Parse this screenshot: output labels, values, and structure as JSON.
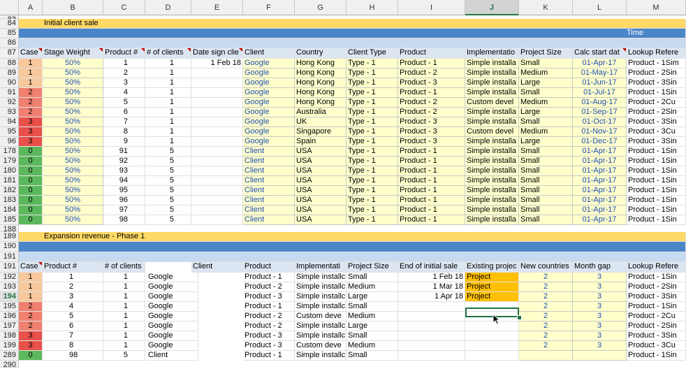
{
  "columns": [
    "A",
    "B",
    "C",
    "D",
    "E",
    "F",
    "G",
    "H",
    "I",
    "J",
    "K",
    "L",
    "M"
  ],
  "selected_column": "J",
  "bands": {
    "initial_title": "Initial client sale",
    "time_label": "Time",
    "expansion_title": "Expansion revenue - Phase 1"
  },
  "row_numbers": {
    "r83": "83",
    "r84": "84",
    "r85": "85",
    "r86": "86",
    "r87": "87",
    "r188": "188",
    "r189": "189",
    "r190": "190",
    "r191": "191",
    "r289": "289",
    "r290": "290"
  },
  "header1": {
    "case": "Case",
    "stage_weight": "Stage Weight",
    "product_num": "Product #",
    "num_clients": "# of clients",
    "date_sign": "Date sign clie",
    "client": "Client",
    "country": "Country",
    "client_type": "Client Type",
    "product": "Product",
    "implementation": "Implementatio",
    "project_size": "Project Size",
    "calc_start": "Calc start dat",
    "lookup_ref": "Lookup Refere"
  },
  "initial_rows": [
    {
      "n": "88",
      "case": "1",
      "w": "50%",
      "p": "1",
      "nc": "1",
      "date": "1 Feb 18",
      "client": "Google",
      "country": "Hong Kong",
      "type": "Type - 1",
      "prod": "Product - 1",
      "impl": "Simple installa",
      "size": "Small",
      "start": "01-Apr-17",
      "ref": "Product - 1Sim"
    },
    {
      "n": "89",
      "case": "1",
      "w": "50%",
      "p": "2",
      "nc": "1",
      "date": "",
      "client": "Google",
      "country": "Hong Kong",
      "type": "Type - 1",
      "prod": "Product - 2",
      "impl": "Simple installa",
      "size": "Medium",
      "start": "01-May-17",
      "ref": "Product - 2Sin"
    },
    {
      "n": "90",
      "case": "1",
      "w": "50%",
      "p": "3",
      "nc": "1",
      "date": "",
      "client": "Google",
      "country": "Hong Kong",
      "type": "Type - 1",
      "prod": "Product - 3",
      "impl": "Simple installa",
      "size": "Large",
      "start": "01-Jun-17",
      "ref": "Product - 3Sin"
    },
    {
      "n": "91",
      "case": "2",
      "w": "50%",
      "p": "4",
      "nc": "1",
      "date": "",
      "client": "Google",
      "country": "Hong Kong",
      "type": "Type - 1",
      "prod": "Product - 1",
      "impl": "Simple installa",
      "size": "Small",
      "start": "01-Jul-17",
      "ref": "Product - 1Sin"
    },
    {
      "n": "92",
      "case": "2",
      "w": "50%",
      "p": "5",
      "nc": "1",
      "date": "",
      "client": "Google",
      "country": "Hong Kong",
      "type": "Type - 1",
      "prod": "Product - 2",
      "impl": "Custom devel",
      "size": "Medium",
      "start": "01-Aug-17",
      "ref": "Product - 2Cu"
    },
    {
      "n": "93",
      "case": "2",
      "w": "50%",
      "p": "6",
      "nc": "1",
      "date": "",
      "client": "Google",
      "country": "Australia",
      "type": "Type - 1",
      "prod": "Product - 2",
      "impl": "Simple installa",
      "size": "Large",
      "start": "01-Sep-17",
      "ref": "Product - 2Sin"
    },
    {
      "n": "94",
      "case": "3",
      "w": "50%",
      "p": "7",
      "nc": "1",
      "date": "",
      "client": "Google",
      "country": "UK",
      "type": "Type - 1",
      "prod": "Product - 3",
      "impl": "Simple installa",
      "size": "Small",
      "start": "01-Oct-17",
      "ref": "Product - 3Sin"
    },
    {
      "n": "95",
      "case": "3",
      "w": "50%",
      "p": "8",
      "nc": "1",
      "date": "",
      "client": "Google",
      "country": "Singapore",
      "type": "Type - 1",
      "prod": "Product - 3",
      "impl": "Custom devel",
      "size": "Medium",
      "start": "01-Nov-17",
      "ref": "Product - 3Cu"
    },
    {
      "n": "96",
      "case": "3",
      "w": "50%",
      "p": "9",
      "nc": "1",
      "date": "",
      "client": "Google",
      "country": "Spain",
      "type": "Type - 1",
      "prod": "Product - 3",
      "impl": "Simple installa",
      "size": "Large",
      "start": "01-Dec-17",
      "ref": "Product - 3Sin"
    },
    {
      "n": "178",
      "case": "0",
      "w": "50%",
      "p": "91",
      "nc": "5",
      "date": "",
      "client": "Client",
      "country": "USA",
      "type": "Type - 1",
      "prod": "Product - 1",
      "impl": "Simple installa",
      "size": "Small",
      "start": "01-Apr-17",
      "ref": "Product - 1Sin"
    },
    {
      "n": "179",
      "case": "0",
      "w": "50%",
      "p": "92",
      "nc": "5",
      "date": "",
      "client": "Client",
      "country": "USA",
      "type": "Type - 1",
      "prod": "Product - 1",
      "impl": "Simple installa",
      "size": "Small",
      "start": "01-Apr-17",
      "ref": "Product - 1Sin"
    },
    {
      "n": "180",
      "case": "0",
      "w": "50%",
      "p": "93",
      "nc": "5",
      "date": "",
      "client": "Client",
      "country": "USA",
      "type": "Type - 1",
      "prod": "Product - 1",
      "impl": "Simple installa",
      "size": "Small",
      "start": "01-Apr-17",
      "ref": "Product - 1Sin"
    },
    {
      "n": "181",
      "case": "0",
      "w": "50%",
      "p": "94",
      "nc": "5",
      "date": "",
      "client": "Client",
      "country": "USA",
      "type": "Type - 1",
      "prod": "Product - 1",
      "impl": "Simple installa",
      "size": "Small",
      "start": "01-Apr-17",
      "ref": "Product - 1Sin"
    },
    {
      "n": "182",
      "case": "0",
      "w": "50%",
      "p": "95",
      "nc": "5",
      "date": "",
      "client": "Client",
      "country": "USA",
      "type": "Type - 1",
      "prod": "Product - 1",
      "impl": "Simple installa",
      "size": "Small",
      "start": "01-Apr-17",
      "ref": "Product - 1Sin"
    },
    {
      "n": "183",
      "case": "0",
      "w": "50%",
      "p": "96",
      "nc": "5",
      "date": "",
      "client": "Client",
      "country": "USA",
      "type": "Type - 1",
      "prod": "Product - 1",
      "impl": "Simple installa",
      "size": "Small",
      "start": "01-Apr-17",
      "ref": "Product - 1Sin"
    },
    {
      "n": "184",
      "case": "0",
      "w": "50%",
      "p": "97",
      "nc": "5",
      "date": "",
      "client": "Client",
      "country": "USA",
      "type": "Type - 1",
      "prod": "Product - 1",
      "impl": "Simple installa",
      "size": "Small",
      "start": "01-Apr-17",
      "ref": "Product - 1Sin"
    },
    {
      "n": "185",
      "case": "0",
      "w": "50%",
      "p": "98",
      "nc": "5",
      "date": "",
      "client": "Client",
      "country": "USA",
      "type": "Type - 1",
      "prod": "Product - 1",
      "impl": "Simple installa",
      "size": "Small",
      "start": "01-Apr-17",
      "ref": "Product - 1Sin"
    }
  ],
  "header2": {
    "case": "Case",
    "product_num": "Product #",
    "num_clients": "# of clients",
    "client": "Client",
    "product": "Product",
    "implementation": "Implementati",
    "project_size": "Project Size",
    "end_initial": "End of initial sale",
    "existing": "Existing projec",
    "new_countries": "New countries",
    "month_gap": "Month gap",
    "lookup_ref": "Lookup Refere"
  },
  "expansion_rows": [
    {
      "n": "192",
      "case": "1",
      "p": "1",
      "nc": "1",
      "client": "Google",
      "prod": "Product - 1",
      "impl": "Simple installc",
      "size": "Small",
      "end": "1 Feb 18",
      "exist": "Project",
      "newc": "2",
      "gap": "3",
      "ref": "Product - 1Sin"
    },
    {
      "n": "193",
      "case": "1",
      "p": "2",
      "nc": "1",
      "client": "Google",
      "prod": "Product - 2",
      "impl": "Simple installc",
      "size": "Medium",
      "end": "1 Mar 18",
      "exist": "Project",
      "newc": "2",
      "gap": "3",
      "ref": "Product - 2Sin"
    },
    {
      "n": "194",
      "case": "1",
      "p": "3",
      "nc": "1",
      "client": "Google",
      "prod": "Product - 3",
      "impl": "Simple installc",
      "size": "Large",
      "end": "1 Apr 18",
      "exist": "Project",
      "newc": "2",
      "gap": "3",
      "ref": "Product - 3Sin"
    },
    {
      "n": "195",
      "case": "2",
      "p": "4",
      "nc": "1",
      "client": "Google",
      "prod": "Product - 1",
      "impl": "Simple installc",
      "size": "Small",
      "end": "",
      "exist": "",
      "newc": "2",
      "gap": "3",
      "ref": "Product - 1Sin"
    },
    {
      "n": "196",
      "case": "2",
      "p": "5",
      "nc": "1",
      "client": "Google",
      "prod": "Product - 2",
      "impl": "Custom deve",
      "size": "Medium",
      "end": "",
      "exist": "",
      "newc": "2",
      "gap": "3",
      "ref": "Product - 2Cu"
    },
    {
      "n": "197",
      "case": "2",
      "p": "6",
      "nc": "1",
      "client": "Google",
      "prod": "Product - 2",
      "impl": "Simple installc",
      "size": "Large",
      "end": "",
      "exist": "",
      "newc": "2",
      "gap": "3",
      "ref": "Product - 2Sin"
    },
    {
      "n": "198",
      "case": "3",
      "p": "7",
      "nc": "1",
      "client": "Google",
      "prod": "Product - 3",
      "impl": "Simple installc",
      "size": "Small",
      "end": "",
      "exist": "",
      "newc": "2",
      "gap": "3",
      "ref": "Product - 3Sin"
    },
    {
      "n": "199",
      "case": "3",
      "p": "8",
      "nc": "1",
      "client": "Google",
      "prod": "Product - 3",
      "impl": "Custom deve",
      "size": "Medium",
      "end": "",
      "exist": "",
      "newc": "2",
      "gap": "3",
      "ref": "Product - 3Cu"
    },
    {
      "n": "289",
      "case": "0",
      "p": "98",
      "nc": "5",
      "client": "Client",
      "prod": "Product - 1",
      "impl": "Simple installc",
      "size": "Small",
      "end": "",
      "exist": "",
      "newc": "",
      "gap": "",
      "ref": "Product - 1Sin"
    }
  ],
  "selected_row": "194"
}
